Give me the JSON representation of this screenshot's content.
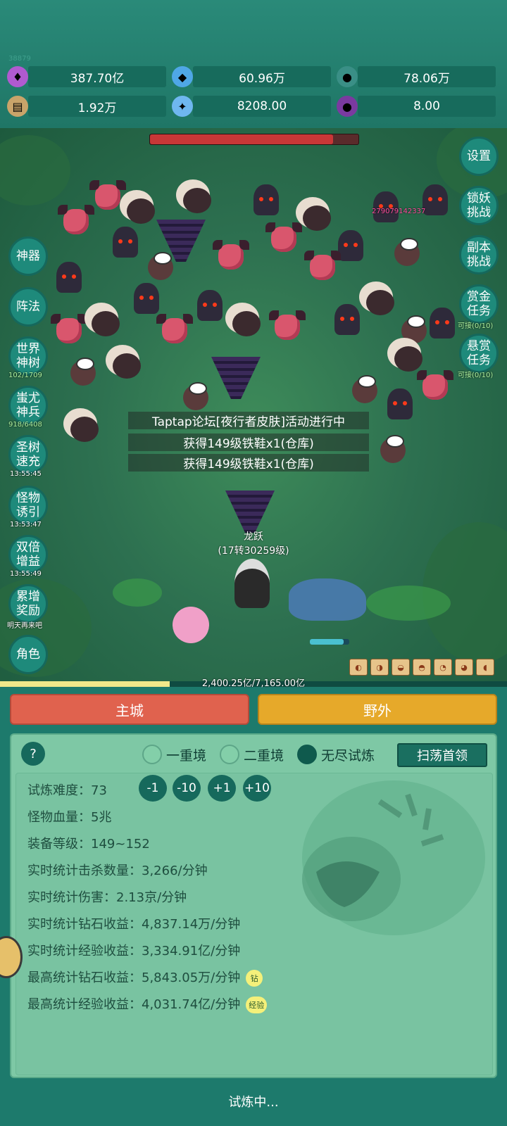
{
  "header": {
    "uid": "38879",
    "resources": [
      {
        "icon": "purple-gem-icon",
        "value": "387.70亿"
      },
      {
        "icon": "blue-diamond-icon",
        "value": "60.96万"
      },
      {
        "icon": "teal-orb-icon",
        "value": "78.06万"
      },
      {
        "icon": "scroll-icon",
        "value": "1.92万"
      },
      {
        "icon": "ice-crystal-icon",
        "value": "8208.00"
      },
      {
        "icon": "purple-pot-icon",
        "value": "8.00"
      }
    ]
  },
  "battle": {
    "damage_number": "279079142337",
    "messages": [
      "Taptap论坛[夜行者皮肤]活动进行中",
      "获得149级铁鞋x1(仓库)",
      "获得149级铁鞋x1(仓库)"
    ],
    "hero": {
      "name": "龙跃",
      "level": "(17转30259级)"
    },
    "boss_hp_fraction": 0.88
  },
  "left_buttons": [
    {
      "label": "神器",
      "sub": ""
    },
    {
      "label": "阵法",
      "sub": ""
    },
    {
      "label": "世界\n神树",
      "sub": "102/1709"
    },
    {
      "label": "蚩尤\n神兵",
      "sub": "918/6408"
    },
    {
      "label": "圣树\n速充",
      "sub": "13:55:45"
    },
    {
      "label": "怪物\n诱引",
      "sub": "13:53:47"
    },
    {
      "label": "双倍\n增益",
      "sub": "13:55:49"
    },
    {
      "label": "累增\n奖励",
      "sub": "明天再来吧"
    },
    {
      "label": "角色",
      "sub": ""
    }
  ],
  "right_buttons": [
    {
      "label": "设置",
      "sub": ""
    },
    {
      "label": "锁妖\n挑战",
      "sub": ""
    },
    {
      "label": "副本\n挑战",
      "sub": ""
    },
    {
      "label": "赏金\n任务",
      "sub": "可接(0/10)"
    },
    {
      "label": "悬赏\n任务",
      "sub": "可接(0/10)"
    }
  ],
  "experience": {
    "text": "2,400.25亿/7,165.00亿",
    "fraction": 0.335
  },
  "tabs": {
    "main_city": "主城",
    "wild": "野外"
  },
  "trial_panel": {
    "help": "?",
    "modes": [
      "一重境",
      "二重境",
      "无尽试炼"
    ],
    "selected_mode": 2,
    "sweep_button": "扫荡首领",
    "difficulty_label": "试炼难度：",
    "difficulty_value": "73",
    "adjust_buttons": [
      "-1",
      "-10",
      "+1",
      "+10"
    ],
    "stats": [
      "怪物血量：5兆",
      "装备等级：149~152",
      "实时统计击杀数量：3,266/分钟",
      "实时统计伤害：2.13京/分钟",
      "实时统计钻石收益：4,837.14万/分钟",
      "实时统计经验收益：3,334.91亿/分钟",
      "最高统计钻石收益：5,843.05万/分钟",
      "最高统计经验收益：4,031.74亿/分钟"
    ],
    "badges": {
      "diamond": "钻",
      "exp": "经验"
    }
  },
  "status": "试炼中..."
}
